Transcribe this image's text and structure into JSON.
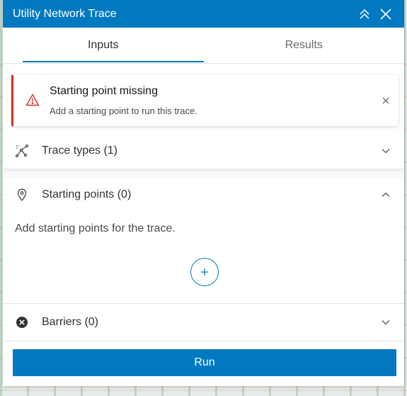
{
  "header": {
    "title": "Utility Network Trace"
  },
  "tabs": [
    {
      "label": "Inputs",
      "active": true
    },
    {
      "label": "Results",
      "active": false
    }
  ],
  "notice": {
    "title": "Starting point missing",
    "message": "Add a starting point to run this trace.",
    "icon": "warning-triangle-icon",
    "color": "#d83020"
  },
  "sections": {
    "trace_types": {
      "label": "Trace types (1)",
      "icon": "trace-types-icon",
      "expanded": false
    },
    "starting_points": {
      "label": "Starting points (0)",
      "icon": "map-pin-icon",
      "expanded": true,
      "description": "Add starting points for the trace."
    },
    "barriers": {
      "label": "Barriers (0)",
      "icon": "x-circle-icon",
      "expanded": false
    }
  },
  "run_button": {
    "label": "Run"
  },
  "colors": {
    "accent": "#0079c1",
    "error": "#d83020"
  }
}
